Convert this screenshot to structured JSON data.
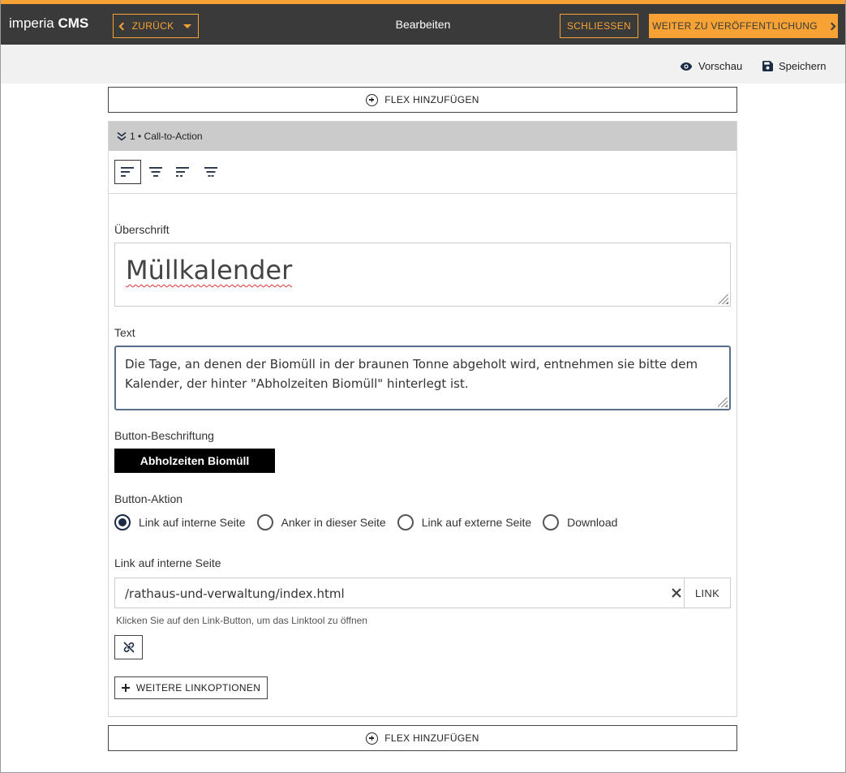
{
  "app": {
    "brand_light": "imperia",
    "brand_bold": "CMS",
    "title": "Bearbeiten"
  },
  "topbar": {
    "back_label": "ZURÜCK",
    "close_label": "SCHLIESSEN",
    "publish_label": "WEITER ZU VERÖFFENTLICHUNG"
  },
  "subbar": {
    "preview_label": "Vorschau",
    "save_label": "Speichern"
  },
  "flex_add_label": "FLEX HINZUFÜGEN",
  "panel": {
    "header": "1 • Call-to-Action",
    "heading_label": "Überschrift",
    "heading_value": "Müllkalender",
    "text_label": "Text",
    "text_value": "Die Tage, an denen der Biomüll in der braunen Tonne abgeholt wird, entnehmen sie bitte dem Kalender, der hinter \"Abholzeiten Biomüll\" hinterlegt ist.",
    "button_caption_label": "Button-Beschriftung",
    "button_caption_value": "Abholzeiten Biomüll",
    "button_action_label": "Button-Aktion",
    "button_actions": [
      {
        "label": "Link auf interne Seite",
        "checked": true
      },
      {
        "label": "Anker in dieser Seite",
        "checked": false
      },
      {
        "label": "Link auf externe Seite",
        "checked": false
      },
      {
        "label": "Download",
        "checked": false
      }
    ],
    "internal_link_label": "Link auf interne Seite",
    "internal_link_value": "/rathaus-und-verwaltung/index.html",
    "link_button_label": "LINK",
    "link_hint": "Klicken Sie auf den Link-Button, um das Linktool zu öffnen",
    "more_link_options_label": "WEITERE LINKOPTIONEN"
  },
  "colors": {
    "accent": "#f7a234",
    "topbar": "#3a3a3a",
    "subbar": "#f1f1f1",
    "panel_header": "#cbcbcb"
  }
}
